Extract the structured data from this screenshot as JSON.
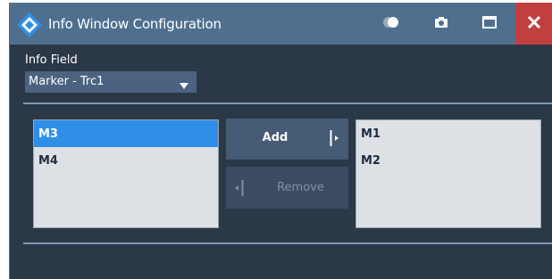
{
  "window": {
    "title": "Info Window Configuration"
  },
  "titlebar_icons": [
    "logo-icon",
    "toggle-icon",
    "camera-icon",
    "maximize-icon",
    "close-icon"
  ],
  "info_field": {
    "label": "Info Field",
    "selected_value": "Marker - Trc1"
  },
  "available_list": {
    "items": [
      {
        "label": "M3",
        "selected": true
      },
      {
        "label": "M4",
        "selected": false
      }
    ]
  },
  "selected_list": {
    "items": [
      {
        "label": "M1"
      },
      {
        "label": "M2"
      }
    ]
  },
  "buttons": {
    "add_label": "Add",
    "remove_label": "Remove",
    "remove_enabled": false
  },
  "colors": {
    "background": "#2b3848",
    "titlebar": "#4f6f8f",
    "close": "#c0403f",
    "selection": "#2f8fe8",
    "list_background": "#dde1e6"
  }
}
